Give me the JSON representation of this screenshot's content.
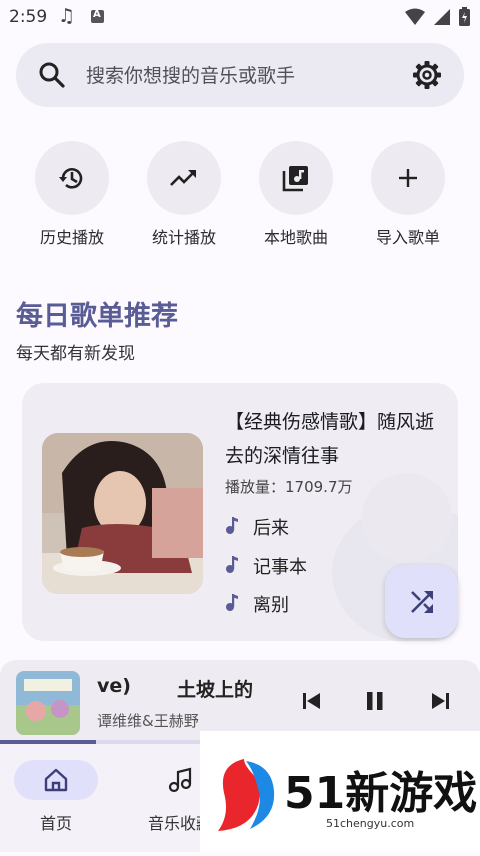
{
  "status_bar": {
    "time": "2:59"
  },
  "search": {
    "placeholder": "搜索你想搜的音乐或歌手"
  },
  "quick_actions": [
    {
      "label": "历史播放",
      "icon": "history-icon"
    },
    {
      "label": "统计播放",
      "icon": "trending-up-icon"
    },
    {
      "label": "本地歌曲",
      "icon": "local-library-icon"
    },
    {
      "label": "导入歌单",
      "icon": "plus-icon"
    }
  ],
  "daily": {
    "title": "每日歌单推荐",
    "subtitle": "每天都有新发现",
    "playlist_title": "【经典伤感情歌】随风逝去的深情往事",
    "play_count": "播放量：1709.7万",
    "songs": [
      "后来",
      "记事本",
      "离别"
    ]
  },
  "player": {
    "title_part1": "ve)",
    "title_part2": "土坡上的",
    "artist": "谭维维&王赫野",
    "progress_fraction": 0.2
  },
  "nav": {
    "items": [
      {
        "label": "首页"
      },
      {
        "label": "音乐收藏"
      }
    ]
  },
  "watermark": {
    "brand": "51新游戏",
    "url": "51chengyu.com"
  },
  "colors": {
    "accent": "#5a5c96",
    "surface": "#efecf3",
    "fab": "#e1e0fa"
  }
}
